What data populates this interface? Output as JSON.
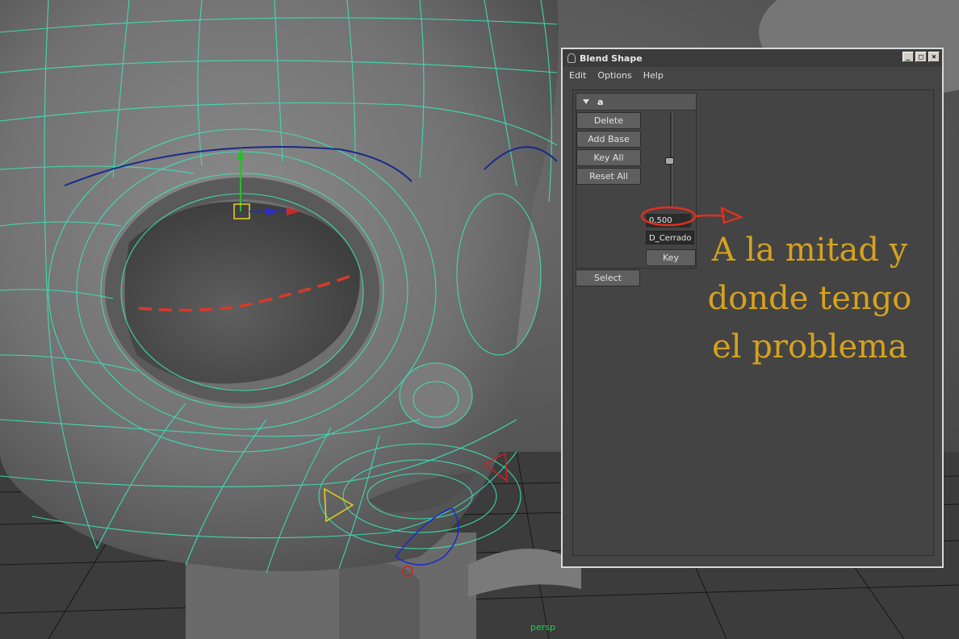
{
  "viewport": {
    "camera_label": "persp"
  },
  "window": {
    "title": "Blend Shape",
    "controls": {
      "minimize": "_",
      "maximize": "□",
      "close": "×"
    }
  },
  "menu": {
    "items": [
      "Edit",
      "Options",
      "Help"
    ]
  },
  "blendshape": {
    "node_name": "a",
    "buttons": {
      "delete": "Delete",
      "add_base": "Add Base",
      "key_all": "Key All",
      "reset_all": "Reset All",
      "key": "Key",
      "select": "Select"
    },
    "weight": "0.500",
    "weight_value": 0.5,
    "target_name": "D_Cerrado"
  },
  "annotation": {
    "lines": [
      "A la mitad y",
      "donde tengo",
      "el problema"
    ],
    "color": "#d6a21e",
    "marker_color": "#e0301e"
  },
  "colors": {
    "wireframe": "#3be6b4",
    "grid": "#000000"
  }
}
